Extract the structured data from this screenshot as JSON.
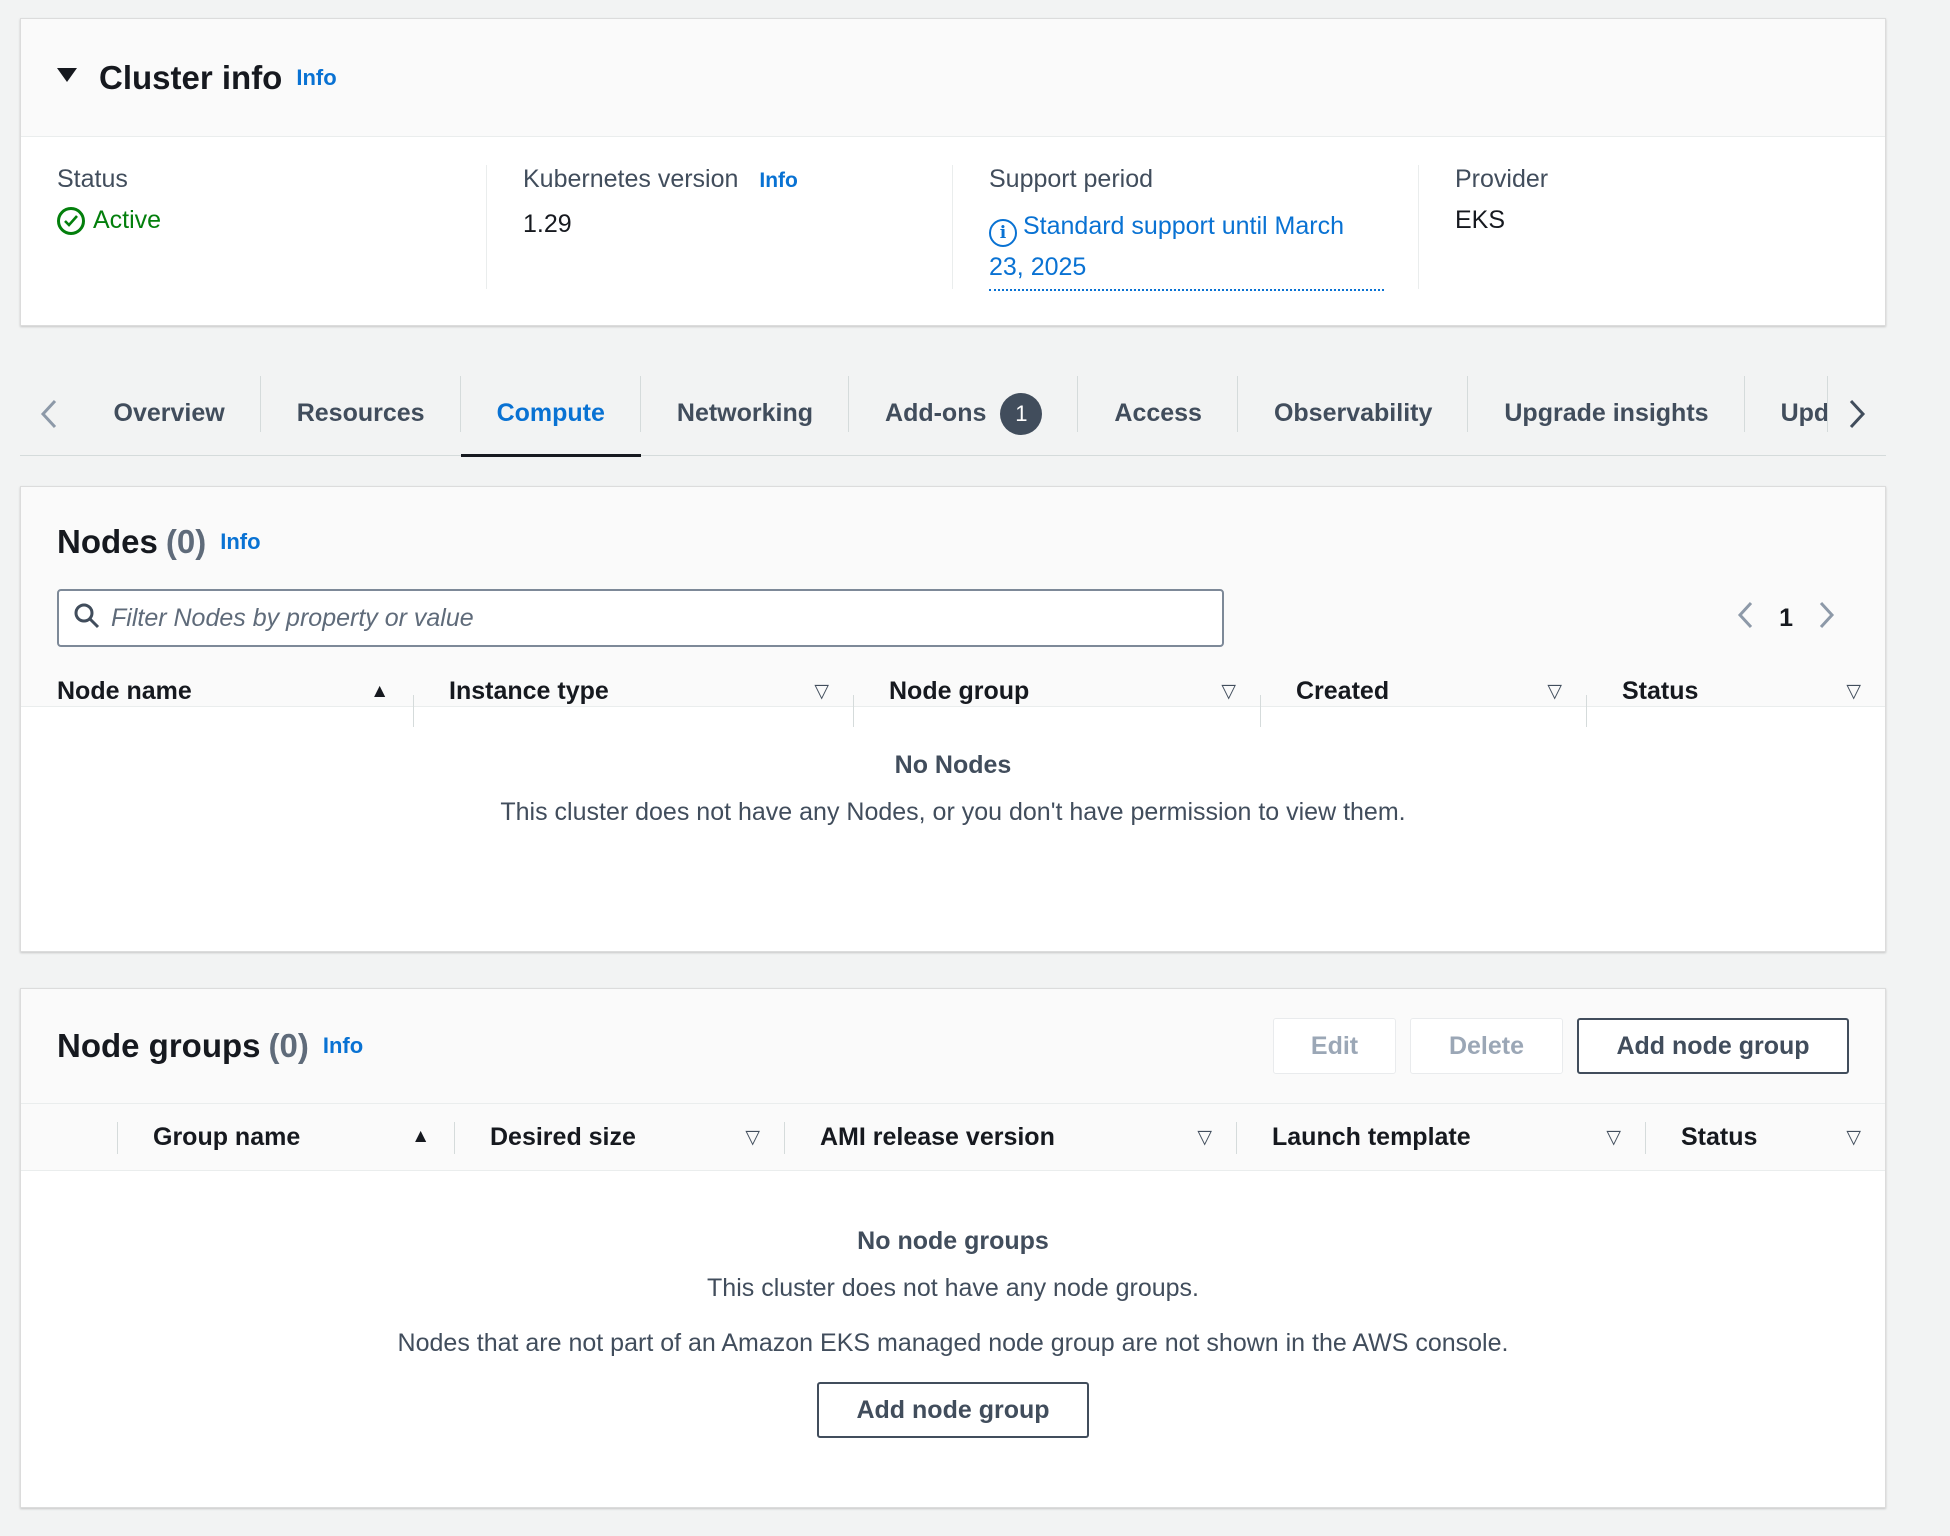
{
  "cluster_info": {
    "title": "Cluster info",
    "info": "Info",
    "status": {
      "label": "Status",
      "value": "Active"
    },
    "k8s_version": {
      "label": "Kubernetes version",
      "info": "Info",
      "value": "1.29"
    },
    "support": {
      "label": "Support period",
      "value": "Standard support until March 23, 2025"
    },
    "provider": {
      "label": "Provider",
      "value": "EKS"
    }
  },
  "tabs": {
    "items": [
      "Overview",
      "Resources",
      "Compute",
      "Networking",
      "Add-ons",
      "Access",
      "Observability",
      "Upgrade insights",
      "Upd"
    ],
    "active": "Compute",
    "addons_badge": "1"
  },
  "nodes": {
    "title": "Nodes",
    "count": "(0)",
    "info": "Info",
    "search_placeholder": "Filter Nodes by property or value",
    "page": "1",
    "columns": [
      "Node name",
      "Instance type",
      "Node group",
      "Created",
      "Status"
    ],
    "empty_title": "No Nodes",
    "empty_desc": "This cluster does not have any Nodes, or you don't have permission to view them."
  },
  "node_groups": {
    "title": "Node groups",
    "count": "(0)",
    "info": "Info",
    "edit": "Edit",
    "delete": "Delete",
    "add": "Add node group",
    "columns": [
      "Group name",
      "Desired size",
      "AMI release version",
      "Launch template",
      "Status"
    ],
    "empty_title": "No node groups",
    "empty_desc": "This cluster does not have any node groups.",
    "empty_note": "Nodes that are not part of an Amazon EKS managed node group are not shown in the AWS console.",
    "empty_button": "Add node group"
  },
  "colors": {
    "link": "#0972d3",
    "success": "#037f0c",
    "text": "#16191f",
    "muted": "#414d5c"
  }
}
